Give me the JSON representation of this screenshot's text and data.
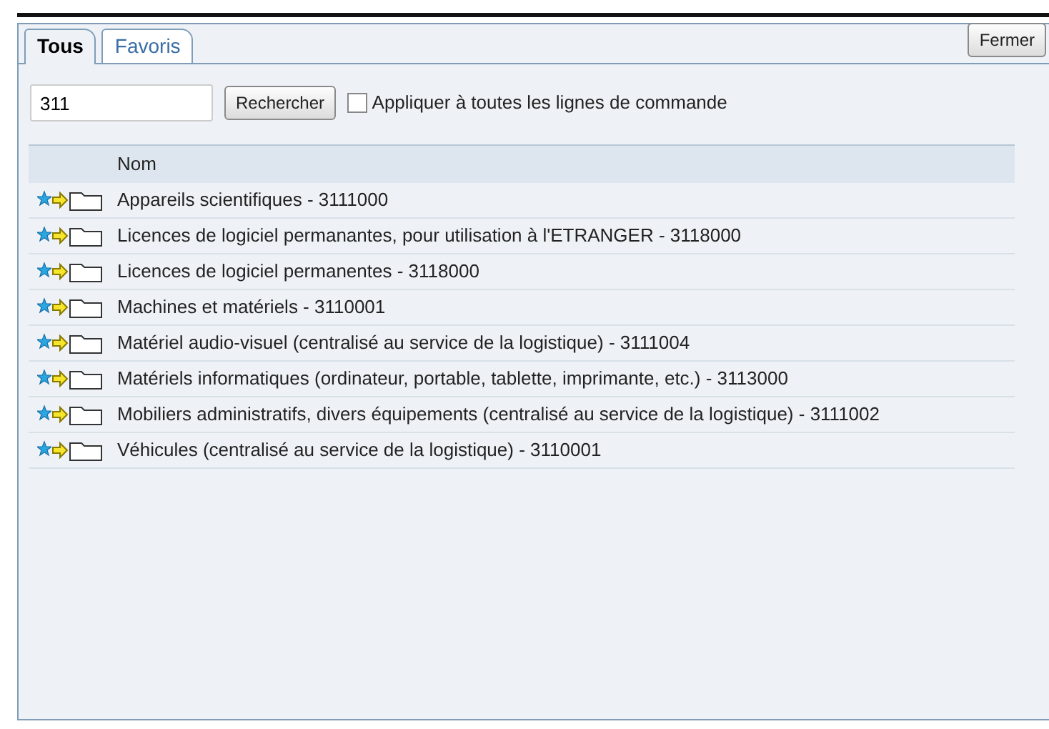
{
  "tabs": [
    {
      "label": "Tous",
      "selected": true
    },
    {
      "label": "Favoris",
      "selected": false
    }
  ],
  "close_button": "Fermer",
  "search": {
    "value": "311",
    "button": "Rechercher",
    "apply_all": {
      "label": "Appliquer à toutes les lignes de commande",
      "checked": false
    }
  },
  "table": {
    "columns": [
      "Nom"
    ],
    "rows": [
      {
        "name": "Appareils scientifiques - 3111000"
      },
      {
        "name": "Licences de logiciel permanantes, pour utilisation à l'ETRANGER - 3118000"
      },
      {
        "name": "Licences de logiciel permanentes - 3118000"
      },
      {
        "name": "Machines et matériels - 3110001"
      },
      {
        "name": "Matériel audio-visuel (centralisé au service de la logistique) - 3111004"
      },
      {
        "name": "Matériels informatiques (ordinateur, portable, tablette, imprimante, etc.) - 3113000"
      },
      {
        "name": "Mobiliers administratifs, divers équipements (centralisé au service de la logistique) - 3111002"
      },
      {
        "name": "Véhicules (centralisé au service de la logistique) - 3110001"
      }
    ]
  }
}
